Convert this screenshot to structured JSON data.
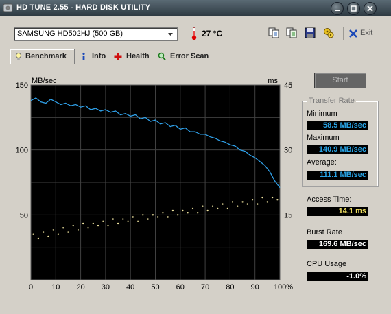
{
  "window": {
    "title": "HD TUNE 2.55 - HARD DISK UTILITY"
  },
  "toolbar": {
    "drive": "SAMSUNG HD502HJ (500 GB)",
    "temperature": "27 °C",
    "exit_label": "Exit"
  },
  "tabs": [
    {
      "label": "Benchmark",
      "icon": "bulb-icon",
      "active": true
    },
    {
      "label": "Info",
      "icon": "info-icon"
    },
    {
      "label": "Health",
      "icon": "health-cross-icon"
    },
    {
      "label": "Error Scan",
      "icon": "magnifier-icon"
    }
  ],
  "side": {
    "start_label": "Start",
    "transfer_rate_title": "Transfer Rate",
    "minimum_label": "Minimum",
    "minimum_value": "58.5 MB/sec",
    "maximum_label": "Maximum",
    "maximum_value": "140.9 MB/sec",
    "average_label": "Average:",
    "average_value": "111.1 MB/sec",
    "access_label": "Access Time:",
    "access_value": "14.1 ms",
    "burst_label": "Burst Rate",
    "burst_value": "169.6 MB/sec",
    "cpu_label": "CPU Usage",
    "cpu_value": "-1.0%"
  },
  "chart_data": {
    "type": "line",
    "left_axis_label": "MB/sec",
    "right_axis_label": "ms",
    "left_ticks": [
      "150",
      "100",
      "50"
    ],
    "right_ticks": [
      "45",
      "30",
      "15"
    ],
    "x_ticks": [
      "0",
      "10",
      "20",
      "30",
      "40",
      "50",
      "60",
      "70",
      "80",
      "90",
      "100%"
    ],
    "xlim": [
      0,
      100
    ],
    "ylim_left": [
      0,
      150
    ],
    "ylim_right": [
      0,
      45
    ],
    "grid": true,
    "series": [
      {
        "axis": "left",
        "color": "#2fa0e8",
        "x": [
          0,
          2,
          4,
          6,
          8,
          10,
          12,
          14,
          16,
          18,
          20,
          22,
          24,
          26,
          28,
          30,
          32,
          34,
          36,
          38,
          40,
          42,
          44,
          46,
          48,
          50,
          52,
          54,
          56,
          58,
          60,
          62,
          64,
          66,
          68,
          70,
          72,
          74,
          76,
          78,
          80,
          82,
          84,
          86,
          88,
          90,
          92,
          94,
          96,
          98,
          100
        ],
        "y": [
          138,
          140,
          137,
          136,
          139,
          137,
          135,
          136,
          134,
          135,
          133,
          134,
          131,
          132,
          130,
          131,
          129,
          130,
          127,
          128,
          126,
          127,
          124,
          125,
          122,
          123,
          120,
          121,
          118,
          119,
          116,
          117,
          114,
          114,
          112,
          112,
          110,
          109,
          107,
          106,
          104,
          103,
          100,
          99,
          96,
          94,
          91,
          88,
          83,
          76,
          71
        ]
      },
      {
        "axis": "right",
        "color": "#f0e4a0",
        "kind": "access-time scatter",
        "x": [
          1,
          3,
          5,
          7,
          9,
          11,
          13,
          15,
          17,
          19,
          21,
          23,
          25,
          27,
          29,
          31,
          33,
          35,
          37,
          39,
          41,
          43,
          45,
          47,
          49,
          51,
          53,
          55,
          57,
          59,
          61,
          63,
          65,
          67,
          69,
          71,
          73,
          75,
          77,
          79,
          81,
          83,
          85,
          87,
          89,
          91,
          93,
          95,
          97,
          99
        ],
        "y": [
          10.5,
          9.5,
          11.0,
          10.0,
          11.5,
          10.5,
          12.0,
          11.0,
          12.5,
          11.5,
          13.0,
          12.0,
          13.0,
          12.5,
          13.5,
          12.5,
          14.0,
          13.0,
          14.0,
          13.5,
          14.5,
          13.5,
          15.0,
          14.0,
          15.0,
          14.5,
          15.5,
          14.5,
          16.0,
          15.0,
          16.0,
          15.5,
          16.5,
          15.5,
          17.0,
          16.0,
          17.0,
          16.5,
          17.5,
          16.5,
          18.0,
          17.0,
          18.0,
          17.5,
          18.5,
          17.5,
          19.0,
          18.0,
          19.0,
          18.5
        ]
      }
    ]
  },
  "colors": {
    "chart_bg": "#000000",
    "grid": "#404040",
    "transfer_line": "#2fa0e8",
    "access_dots": "#f0e4a0"
  }
}
